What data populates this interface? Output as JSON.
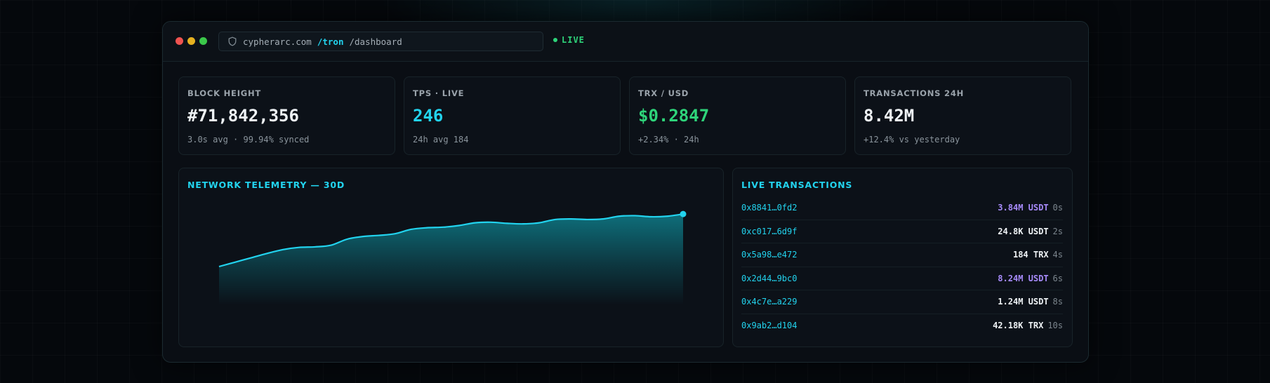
{
  "browser": {
    "domain": "cypherarc.com",
    "path_active": "/tron",
    "path": "/dashboard",
    "live_label": "LIVE"
  },
  "stats": [
    {
      "label": "BLOCK HEIGHT",
      "value": "#71,842,356",
      "sub": "3.0s avg · 99.94% synced",
      "value_color": "#eef2f5"
    },
    {
      "label": "TPS · LIVE",
      "value": "246",
      "sub": "24h avg 184",
      "value_color": "#22d3ee"
    },
    {
      "label": "TRX / USD",
      "value": "$0.2847",
      "sub": "+2.34% · 24h",
      "value_color": "#2ed47a"
    },
    {
      "label": "TRANSACTIONS 24H",
      "value": "8.42M",
      "sub": "+12.4% vs yesterday",
      "value_color": "#eef2f5"
    }
  ],
  "telemetry": {
    "title": "NETWORK TELEMETRY — 30D"
  },
  "chart_data": {
    "type": "area",
    "title": "NETWORK TELEMETRY — 30D",
    "xlabel": "",
    "ylabel": "",
    "x": [
      1,
      2,
      3,
      4,
      5,
      6,
      7,
      8,
      9,
      10,
      11,
      12,
      13,
      14,
      15,
      16,
      17,
      18,
      19,
      20,
      21,
      22,
      23,
      24,
      25,
      26,
      27,
      28,
      29,
      30
    ],
    "series": [
      {
        "values": [
          0.0,
          0.08,
          0.16,
          0.24,
          0.31,
          0.35,
          0.36,
          0.39,
          0.5,
          0.55,
          0.57,
          0.6,
          0.68,
          0.71,
          0.72,
          0.75,
          0.8,
          0.81,
          0.79,
          0.78,
          0.8,
          0.86,
          0.87,
          0.86,
          0.87,
          0.92,
          0.93,
          0.91,
          0.92,
          0.96
        ]
      }
    ],
    "ylim": [
      0,
      1
    ],
    "grid": false,
    "colors": {
      "line": "#22d3ee",
      "fill_top": "#0e7f8c",
      "endpoint": "#22d3ee"
    }
  },
  "transactions": {
    "title": "LIVE TRANSACTIONS",
    "rows": [
      {
        "hash": "0x8841…0fd2",
        "amount": "3.84M USDT",
        "time": "0s",
        "accent": true
      },
      {
        "hash": "0xc017…6d9f",
        "amount": "24.8K USDT",
        "time": "2s",
        "accent": false
      },
      {
        "hash": "0x5a98…e472",
        "amount": "184 TRX",
        "time": "4s",
        "accent": false
      },
      {
        "hash": "0x2d44…9bc0",
        "amount": "8.24M USDT",
        "time": "6s",
        "accent": true
      },
      {
        "hash": "0x4c7e…a229",
        "amount": "1.24M USDT",
        "time": "8s",
        "accent": false
      },
      {
        "hash": "0x9ab2…d104",
        "amount": "42.18K TRX",
        "time": "10s",
        "accent": false
      }
    ]
  }
}
